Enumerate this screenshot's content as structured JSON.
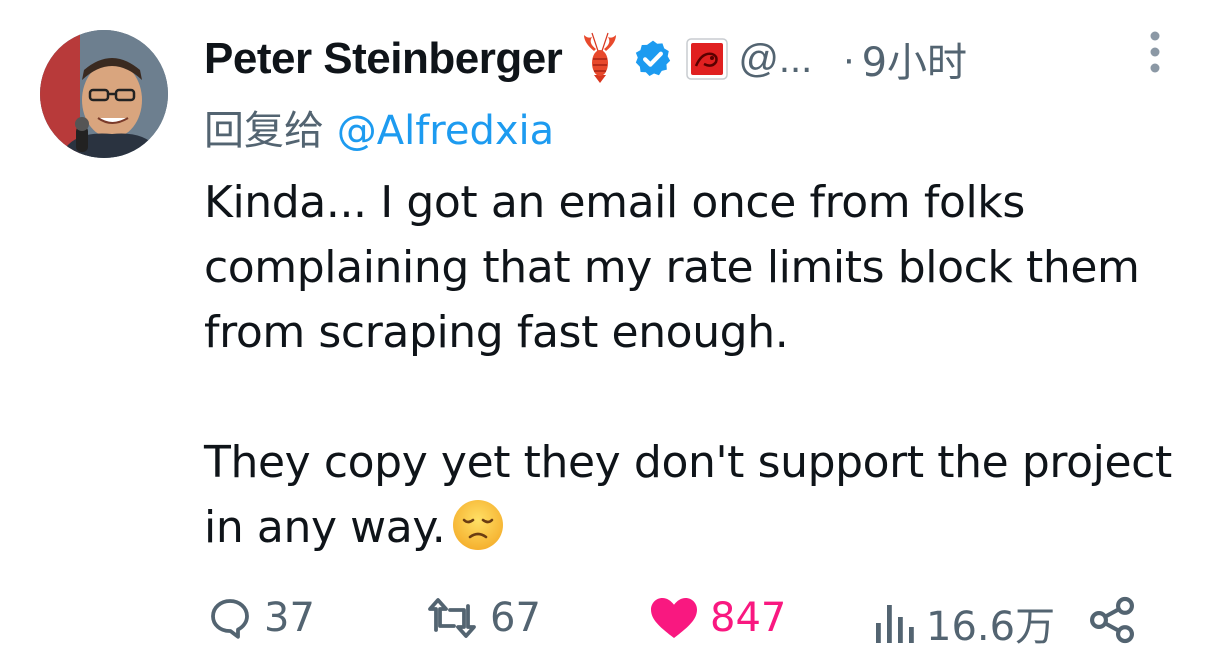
{
  "tweet": {
    "author_name": "Peter Steinberger",
    "handle": "@...",
    "separator": "·",
    "time": "9小时",
    "reply_prefix": "回复给 ",
    "reply_to": "@Alfredxia",
    "paragraph1": "Kinda... I got an email once from folks complaining that my rate limits block them from scraping fast enough.",
    "paragraph2": "They copy yet they don't support the project in any way.",
    "icons": [
      "lobster-emoji",
      "verified-badge-icon",
      "affiliation-badge",
      "more-icon",
      "sad-face-emoji",
      "reply-icon",
      "retweet-icon",
      "like-icon",
      "views-icon",
      "share-icon"
    ]
  },
  "actions": {
    "replies": "37",
    "retweets": "67",
    "likes": "847",
    "views": "16.6万"
  },
  "colors": {
    "primary_text": "#0f1419",
    "secondary_text": "#536471",
    "link": "#1d9bf0",
    "like": "#f91880"
  }
}
